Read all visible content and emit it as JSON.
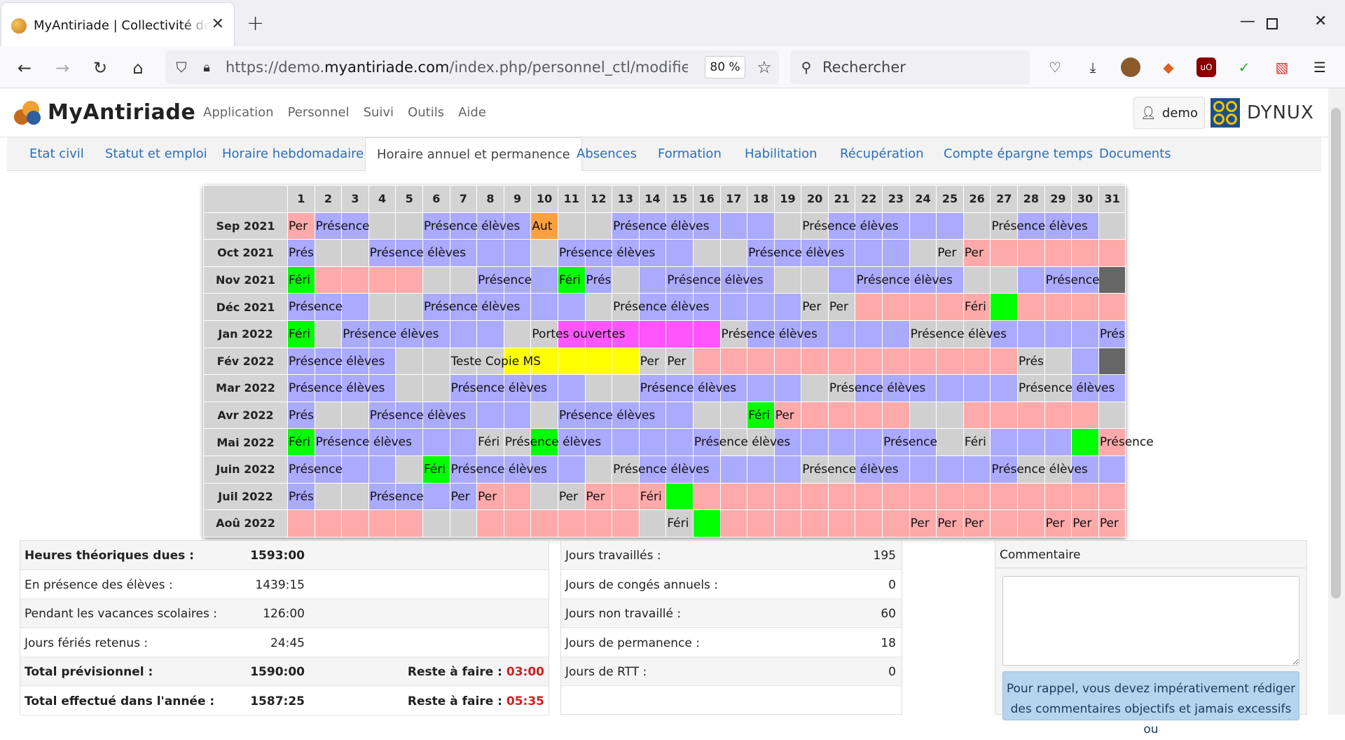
{
  "browser": {
    "tab_title": "MyAntiriade | Collectivité de dém",
    "url_prefix": "https://demo.",
    "url_domain": "myantiriade.com",
    "url_path": "/index.php/personnel_ctl/modifier_personn",
    "zoom": "80 %",
    "search_placeholder": "Rechercher"
  },
  "app": {
    "logo_text": "MyAntiriade",
    "nav": [
      "Application",
      "Personnel",
      "Suivi",
      "Outils",
      "Aide"
    ],
    "user": "demo",
    "brand": "DYNUX"
  },
  "tabs": [
    "Etat civil",
    "Statut et emploi",
    "Horaire hebdomadaire",
    "Horaire annuel et permanence",
    "Absences",
    "Formation",
    "Habilitation",
    "Récupération",
    "Compte épargne temps",
    "Documents"
  ],
  "active_tab": 3,
  "calendar": {
    "days": [
      "1",
      "2",
      "3",
      "4",
      "5",
      "6",
      "7",
      "8",
      "9",
      "10",
      "11",
      "12",
      "13",
      "14",
      "15",
      "16",
      "17",
      "18",
      "19",
      "20",
      "21",
      "22",
      "23",
      "24",
      "25",
      "26",
      "27",
      "28",
      "29",
      "30",
      "31"
    ],
    "legend_colors": {
      "p": "#aaaaff",
      "v": "#ffaaaa",
      "g": "#d0d0d0",
      "f": "#00ff00",
      "x": "#666666",
      "o": "#ffa040",
      "m": "#ff55ff",
      "y": "#ffff00"
    },
    "months": [
      {
        "name": "Sep 2021",
        "cells": "vppggppppoggppppppggpppppggpppgx",
        "labels": {
          "1": "Per",
          "2": "Présence",
          "6": "Présence élèves",
          "10": "Aut",
          "13": "Présence élèves",
          "20": "Présence élèves",
          "27": "Présence élèves"
        }
      },
      {
        "name": "Oct 2021",
        "cells": "pggppppppgpppppggppppppggvvvvvvvg",
        "labels": {
          "1": "Prés",
          "4": "Présence élèves",
          "11": "Présence élèves",
          "18": "Présence élèves",
          "25": "Per",
          "26": "Per"
        }
      },
      {
        "name": "Nov 2021",
        "cells": "fvvvvggpppfpgpppppggpppppggpppx",
        "labels": {
          "1": "Féri",
          "8": "Présence",
          "11": "Féri",
          "12": "Prés",
          "15": "Présence élèves",
          "22": "Présence élèves",
          "29": "Présence"
        }
      },
      {
        "name": "Déc 2021",
        "cells": "pppggppppppggppppppggvvvvvfvvvvv",
        "labels": {
          "1": "Présence",
          "6": "Présence élèves",
          "13": "Présence élèves",
          "20": "Per",
          "21": "Per",
          "26": "Féri"
        }
      },
      {
        "name": "Jan 2022",
        "cells": "fgppppppggmmmmmmgppppppgggppppppggp",
        "labels": {
          "1": "Féri",
          "3": "Présence élèves",
          "10": "Portes ouvertes",
          "17": "Présence élèves",
          "24": "Présence élèves",
          "31": "Prés"
        }
      },
      {
        "name": "Fév 2022",
        "cells": "ppppggggyyyyyggvvvvvvvvvvvvggpxxx",
        "labels": {
          "1": "Présence élèves",
          "7": "Teste Copie MS",
          "14": "Per",
          "15": "Per",
          "28": "Prés"
        }
      },
      {
        "name": "Mar 2022",
        "cells": "ppppggpppppggppppppggppppppggppppp",
        "labels": {
          "1": "Présence élèves",
          "7": "Présence élèves",
          "14": "Présence élèves",
          "21": "Présence élèves",
          "28": "Présence élèves"
        }
      },
      {
        "name": "Avr 2022",
        "cells": "pggppppppgpppppggfvvvvvggvvvvvgx",
        "labels": {
          "1": "Prés",
          "4": "Présence élèves",
          "11": "Présence élèves",
          "18": "Féri",
          "19": "Per"
        }
      },
      {
        "name": "Mai 2022",
        "cells": "fppppppggfppppppggppppppggpppfvggp",
        "labels": {
          "1": "Féri",
          "2": "Présence élèves",
          "8": "Féri",
          "9": "Présence élèves",
          "16": "Présence élèves",
          "23": "Présence",
          "26": "Féri",
          "31": "Présence"
        }
      },
      {
        "name": "Juin 2022",
        "cells": "ppppgfpppppggppppppggppppppggpppx",
        "labels": {
          "1": "Présence",
          "6": "Féri",
          "7": "Présence élèves",
          "13": "Présence élèves",
          "20": "Présence élèves",
          "27": "Présence élèves"
        }
      },
      {
        "name": "Juil 2022",
        "cells": "pggppppvvggvvvfvvvvvvvvvvvvvvvvvv",
        "labels": {
          "1": "Prés",
          "4": "Présence",
          "7": "Per",
          "8": "Per",
          "11": "Per",
          "12": "Per",
          "14": "Féri"
        }
      },
      {
        "name": "Aoû 2022",
        "cells": "vvvvvggvvvvvvggfvvvvvvvvvvvvvvvvv",
        "labels": {
          "15": "Féri",
          "24": "Per",
          "25": "Per",
          "26": "Per",
          "29": "Per",
          "30": "Per",
          "31": "Per"
        }
      }
    ]
  },
  "hours": {
    "rows": [
      {
        "label": "Heures théoriques dues :",
        "value": "1593:00",
        "bold": true
      },
      {
        "label": "En présence des élèves :",
        "value": "1439:15"
      },
      {
        "label": "Pendant les vacances scolaires :",
        "value": "126:00"
      },
      {
        "label": "Jours fériés retenus :",
        "value": "24:45"
      },
      {
        "label": "Total prévisionnel :",
        "value": "1590:00",
        "bold": true,
        "reste_label": "Reste à faire :",
        "reste": "03:00"
      },
      {
        "label": "Total effectué dans l'année :",
        "value": "1587:25",
        "bold": true,
        "reste_label": "Reste à faire :",
        "reste": "05:35"
      }
    ]
  },
  "days_stats": {
    "rows": [
      {
        "label": "Jours travaillés :",
        "value": "195"
      },
      {
        "label": "Jours de congés annuels :",
        "value": "0"
      },
      {
        "label": "Jours non travaillé :",
        "value": "60"
      },
      {
        "label": "Jours de permanence :",
        "value": "18"
      },
      {
        "label": "Jours de RTT :",
        "value": "0"
      }
    ]
  },
  "comment": {
    "title": "Commentaire",
    "note": "Pour rappel, vous devez impérativement rédiger des commentaires objectifs et jamais excessifs ou"
  }
}
